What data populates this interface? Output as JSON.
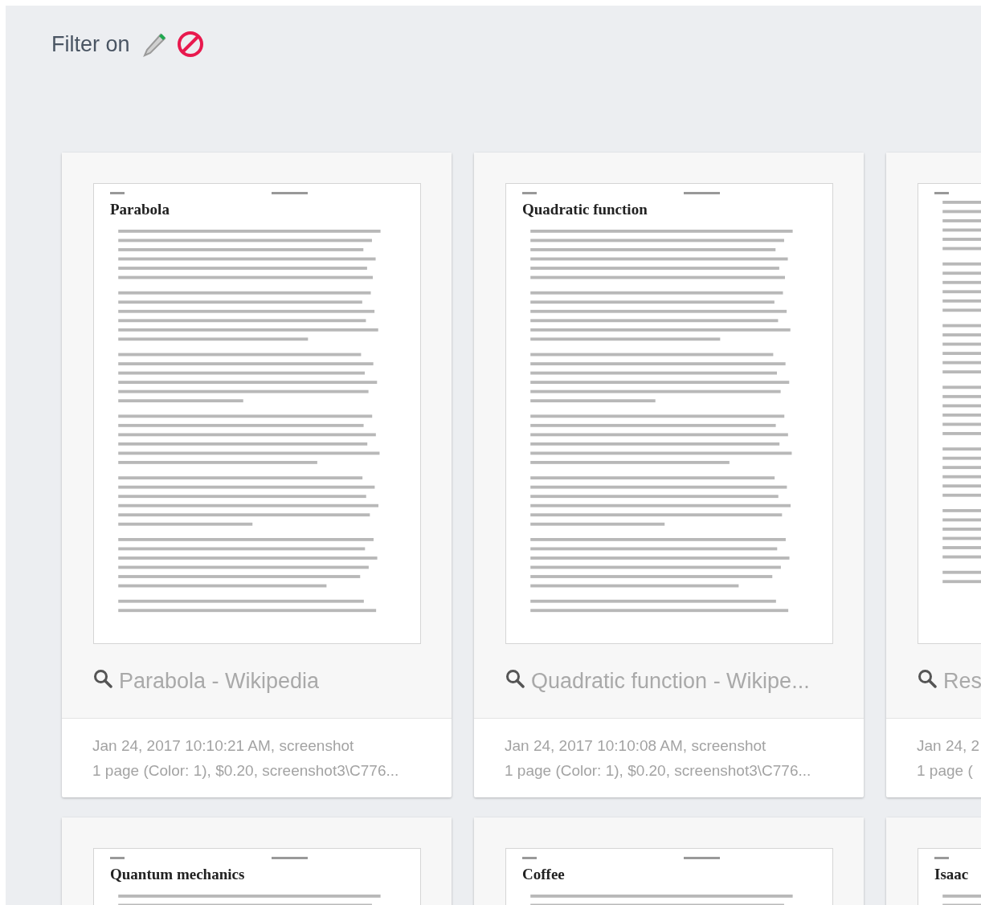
{
  "filter": {
    "label": "Filter on"
  },
  "cards": [
    {
      "title": "Parabola - Wikipedia",
      "meta": [
        "Jan 24, 2017 10:10:21 AM, screenshot",
        "1 page (Color: 1), $0.20, screenshot3\\C776..."
      ],
      "document": {
        "heading": "Parabola"
      }
    },
    {
      "title": "Quadratic function - Wikipe...",
      "meta": [
        "Jan 24, 2017 10:10:08 AM, screenshot",
        "1 page (Color: 1), $0.20, screenshot3\\C776..."
      ],
      "document": {
        "heading": "Quadratic function"
      }
    },
    {
      "title": "Res",
      "meta": [
        "Jan 24, 2",
        "1 page ("
      ]
    },
    {
      "document": {
        "heading": "Quantum mechanics"
      }
    },
    {
      "document": {
        "heading": "Coffee"
      }
    },
    {
      "document": {
        "heading": "Isaac"
      }
    }
  ]
}
